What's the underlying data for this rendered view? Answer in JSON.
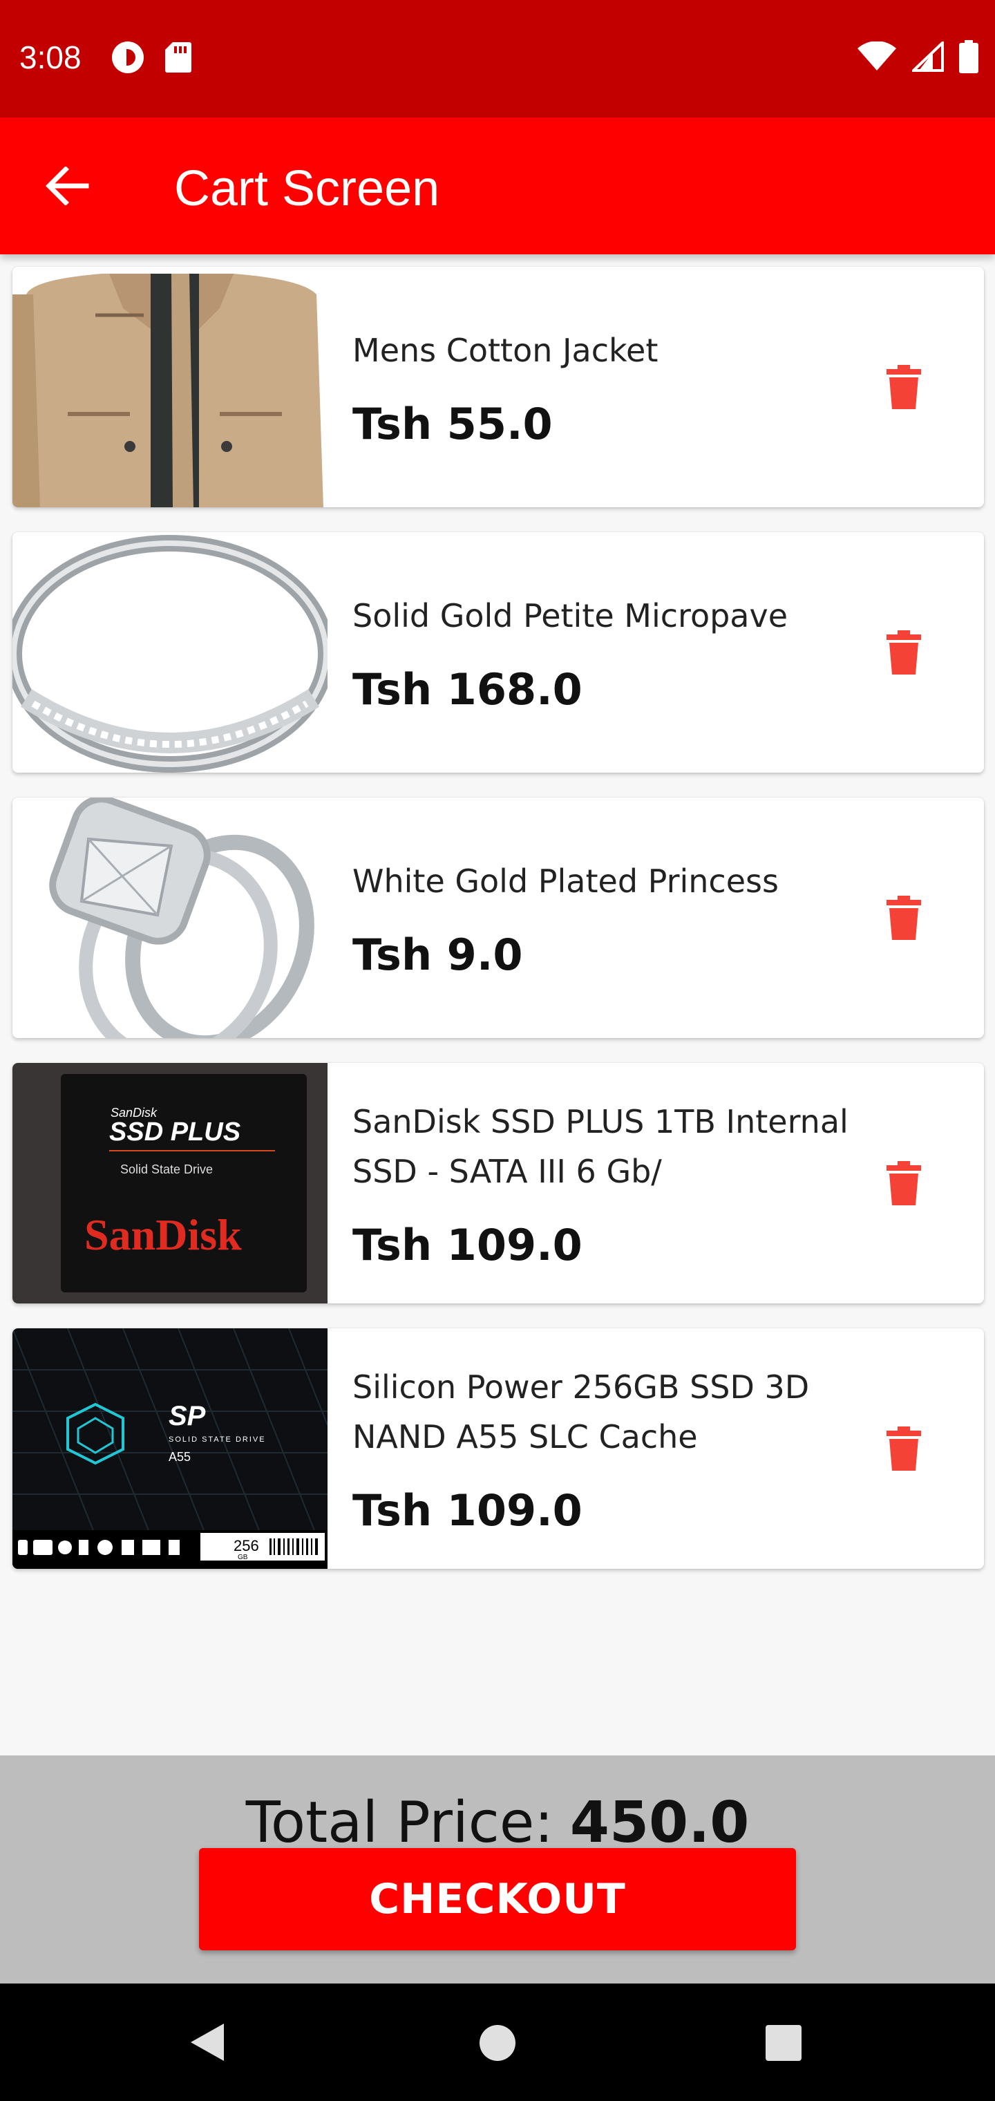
{
  "status_bar": {
    "time": "3:08",
    "left_icons": [
      "pocket-casts-icon",
      "sd-card-icon"
    ],
    "right_icons": [
      "wifi-icon",
      "cell-signal-icon",
      "battery-icon"
    ]
  },
  "app_bar": {
    "title": "Cart Screen",
    "back_icon": "arrow-back-icon"
  },
  "cart": {
    "items": [
      {
        "name": "Mens Cotton Jacket",
        "price": "Tsh 55.0",
        "image": "jacket-photo"
      },
      {
        "name": "Solid Gold Petite Micropave",
        "price": "Tsh 168.0",
        "image": "ring-band-photo"
      },
      {
        "name": "White Gold Plated Princess",
        "price": "Tsh 9.0",
        "image": "diamond-ring-photo"
      },
      {
        "name": "SanDisk SSD PLUS 1TB Internal SSD - SATA III 6 Gb/",
        "price": "Tsh 109.0",
        "image": "sandisk-ssd-photo",
        "image_text": {
          "brand_small": "SanDisk",
          "product": "SSD PLUS",
          "subtitle": "Solid State Drive",
          "logo": "SanDisk"
        }
      },
      {
        "name": "Silicon Power 256GB SSD 3D NAND A55 SLC Cache",
        "price": "Tsh 109.0",
        "image": "silicon-power-ssd-photo",
        "image_text": {
          "logo": "SP",
          "tagline": "SOLID STATE DRIVE",
          "model": "A55",
          "capacity": "256",
          "unit": "GB"
        }
      }
    ],
    "delete_icon": "trash-icon"
  },
  "summary": {
    "total_label": "Total Price:",
    "total_value": "450.0",
    "checkout_label": "CHECKOUT"
  },
  "colors": {
    "status_bar": "#c20000",
    "app_bar": "#ff0000",
    "delete_icon": "#f44336",
    "bottom_panel": "#bdbdbd",
    "checkout": "#ff0000"
  },
  "nav_bar": {
    "icons": [
      "nav-back-icon",
      "nav-home-icon",
      "nav-recents-icon"
    ]
  }
}
